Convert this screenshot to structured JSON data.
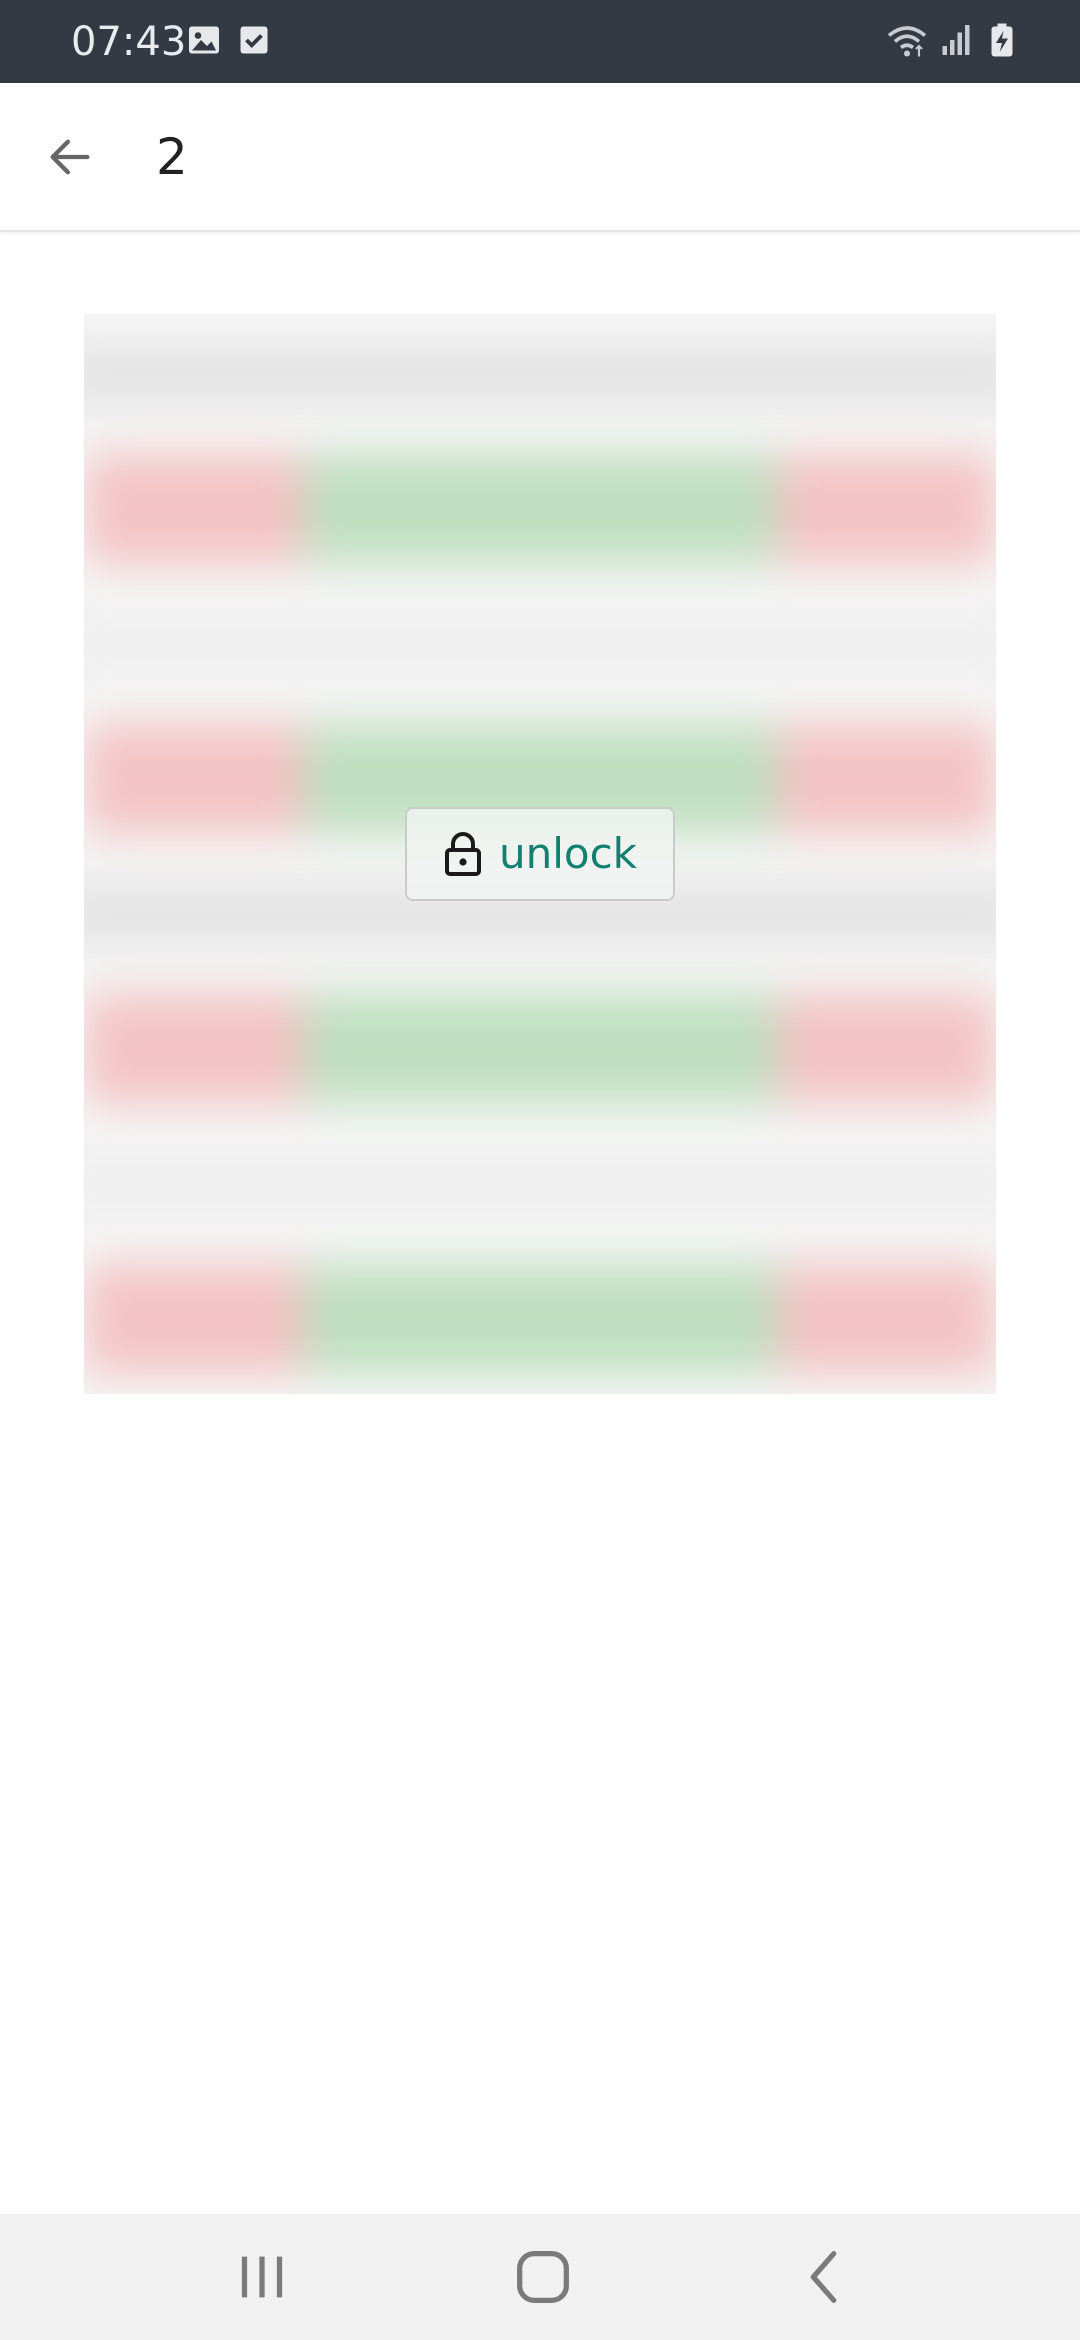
{
  "status_bar": {
    "time": "07:43",
    "icons": [
      "image-icon",
      "checkbox-icon",
      "wifi-icon",
      "signal-icon",
      "battery-charging-icon"
    ],
    "background": "#333a44"
  },
  "header": {
    "title": "2",
    "back_icon": "arrow-left-icon"
  },
  "content": {
    "unlock_button": {
      "label": "unlock",
      "icon": "lock-icon",
      "label_color": "#128070"
    }
  },
  "nav_bar": {
    "buttons": [
      "recent-apps-icon",
      "home-icon",
      "back-chevron-icon"
    ]
  }
}
